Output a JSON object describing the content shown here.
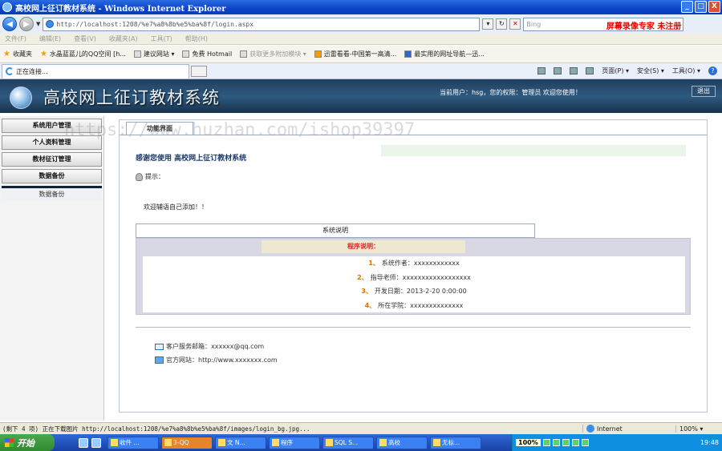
{
  "window": {
    "title": "高校网上征订教材系统 - Windows Internet Explorer",
    "min": "_",
    "max": "□",
    "close": "X"
  },
  "address": {
    "url": "http://localhost:1208/%e7%a8%8b%e5%ba%8f/login.aspx",
    "search_placeholder": "Bing",
    "recorder": "屏幕录像专家 未注册"
  },
  "menu": [
    "文件(F)",
    "编辑(E)",
    "查看(V)",
    "收藏夹(A)",
    "工具(T)",
    "帮助(H)"
  ],
  "favorites": {
    "label": "收藏夹",
    "items": [
      "水晶蓝蓝儿的QQ空间 [h...",
      "建议网站 ▾",
      "免费 Hotmail",
      "获取更多附加模块 ▾",
      "迅雷看看-中国第一高清...",
      "最实用的网址导航—迅..."
    ]
  },
  "tab": {
    "label": "正在连接..."
  },
  "commands": [
    "页面(P) ▾",
    "安全(S) ▾",
    "工具(O) ▾"
  ],
  "header": {
    "system_title": "高校网上征订教材系统",
    "user_info": "当前用户：hsg，您的权限：管理员 欢迎您使用！",
    "logout": "退出"
  },
  "sidebar": {
    "items": [
      "系统用户管理",
      "个人资料管理",
      "教材征订管理",
      "数据备份"
    ],
    "subitem": "数据备份"
  },
  "main": {
    "tab": "功能界面",
    "welcome": "感谢您使用 高校网上征订教材系统",
    "hint_label": "提示：",
    "hint_text": "欢迎辅语自己添加！！",
    "sys_tab": "系统说明",
    "program_title": "程序说明：",
    "rows": [
      {
        "num": "1、",
        "text": "系统作者：xxxxxxxxxxxx"
      },
      {
        "num": "2、",
        "text": "指导老师：xxxxxxxxxxxxxxxxxx"
      },
      {
        "num": "3、",
        "text": "开发日期：2013-2-20 0:00:00"
      },
      {
        "num": "4、",
        "text": "所在学院：xxxxxxxxxxxxxx"
      }
    ],
    "email": "客户服务邮箱：xxxxxx@qq.com",
    "website": "官方网站：http://www.xxxxxxx.com"
  },
  "watermark": "https://www.huzhan.com/ishop39397",
  "status": {
    "left": "(剩下 4 项) 正在下载图片 http://localhost:1208/%e7%a8%8b%e5%ba%8f/images/login_bg.jpg...",
    "zone": "Internet",
    "zoom": "100% ▾"
  },
  "taskbar": {
    "start": "开始",
    "tasks": [
      "收件 ...",
      "3-QQ",
      "文 N...",
      "程序",
      "SQL S...",
      "高校",
      "无标..."
    ],
    "percent": "100%",
    "clock": "19:48"
  }
}
